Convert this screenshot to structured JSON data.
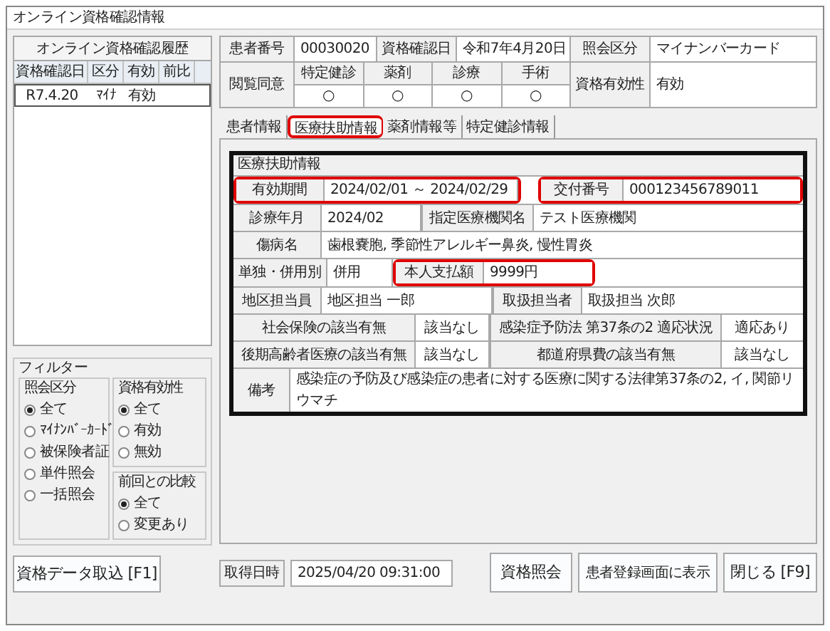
{
  "window": {
    "title": "オンライン資格確認情報"
  },
  "history": {
    "title": "オンライン資格確認履歴",
    "columns": [
      "資格確認日",
      "区分",
      "有効",
      "前比"
    ],
    "rows": [
      {
        "cells": [
          "R7.4.20",
          "ﾏｲﾅ",
          "有効"
        ],
        "selected": true
      }
    ]
  },
  "filter": {
    "title": "フィルター",
    "groups": [
      {
        "title": "照会区分",
        "options": [
          {
            "label": "全て",
            "selected": true
          },
          {
            "label": "ﾏｲﾅﾝﾊﾞｰｶｰﾄﾞ",
            "selected": false
          },
          {
            "label": "被保険者証",
            "selected": false
          },
          {
            "label": "単件照会",
            "selected": false
          },
          {
            "label": "一括照会",
            "selected": false
          }
        ]
      },
      {
        "title": "資格有効性",
        "options": [
          {
            "label": "全て",
            "selected": true
          },
          {
            "label": "有効",
            "selected": false
          },
          {
            "label": "無効",
            "selected": false
          }
        ]
      },
      {
        "title": "前回との比較",
        "options": [
          {
            "label": "全て",
            "selected": true
          },
          {
            "label": "変更あり",
            "selected": false
          }
        ]
      }
    ]
  },
  "import_button": "資格データ取込 [F1]",
  "patient": {
    "fields": [
      {
        "label": "患者番号",
        "value": "00030020"
      },
      {
        "label": "資格確認日",
        "value": "令和7年4月20日"
      },
      {
        "label": "照会区分",
        "value": "マイナンバーカード"
      }
    ],
    "consent": {
      "label": "閲覧同意",
      "items": [
        {
          "label": "特定健診",
          "value": "○"
        },
        {
          "label": "薬剤",
          "value": "○"
        },
        {
          "label": "診療",
          "value": "○"
        },
        {
          "label": "手術",
          "value": "○"
        }
      ]
    },
    "validity": {
      "label": "資格有効性",
      "value": "有効"
    }
  },
  "tabs": [
    {
      "label": "患者情報",
      "selected": false,
      "highlighted": false
    },
    {
      "label": "医療扶助情報",
      "selected": true,
      "highlighted": true
    },
    {
      "label": "薬剤情報等",
      "selected": false,
      "highlighted": false
    },
    {
      "label": "特定健診情報",
      "selected": false,
      "highlighted": false
    }
  ],
  "medical_aid": {
    "title": "医療扶助情報",
    "rows": [
      {
        "pairs": [
          {
            "label": "有効期間",
            "value": "2024/02/01 ～ 2024/02/29",
            "highlighted": true
          },
          {
            "label": "交付番号",
            "value": "000123456789011",
            "highlighted": true
          }
        ]
      },
      {
        "pairs": [
          {
            "label": "診療年月",
            "value": "2024/02",
            "highlighted": false
          },
          {
            "label": "指定医療機関名",
            "value": "テスト医療機関",
            "highlighted": false
          }
        ]
      },
      {
        "pairs": [
          {
            "label": "傷病名",
            "value": "歯根嚢胞, 季節性アレルギー鼻炎, 慢性胃炎",
            "highlighted": false
          }
        ]
      },
      {
        "pairs": [
          {
            "label": "単独・併用別",
            "value": "併用",
            "highlighted": false
          },
          {
            "label": "本人支払額",
            "value": "9999円",
            "highlighted": true
          }
        ]
      },
      {
        "pairs": [
          {
            "label": "地区担当員",
            "value": "地区担当 一郎",
            "highlighted": false
          },
          {
            "label": "取扱担当者",
            "value": "取扱担当 次郎",
            "highlighted": false
          }
        ]
      },
      {
        "pairs": [
          {
            "label": "社会保険の該当有無",
            "value": "該当なし",
            "highlighted": false
          },
          {
            "label": "感染症予防法 第37条の2 適応状況",
            "value": "適応あり",
            "highlighted": false
          }
        ]
      },
      {
        "pairs": [
          {
            "label": "後期高齢者医療の該当有無",
            "value": "該当なし",
            "highlighted": false
          },
          {
            "label": "都道府県費の該当有無",
            "value": "該当なし",
            "highlighted": false
          }
        ]
      },
      {
        "pairs": [
          {
            "label": "備考",
            "value": "感染症の予防及び感染症の患者に対する医療に関する法律第37条の2, イ, 関節リウマチ",
            "highlighted": false
          }
        ]
      }
    ]
  },
  "acquired": {
    "label": "取得日時",
    "value": "2025/04/20 09:31:00"
  },
  "buttons": [
    "資格照会",
    "患者登録画面に表示",
    "閉じる [F9]"
  ]
}
